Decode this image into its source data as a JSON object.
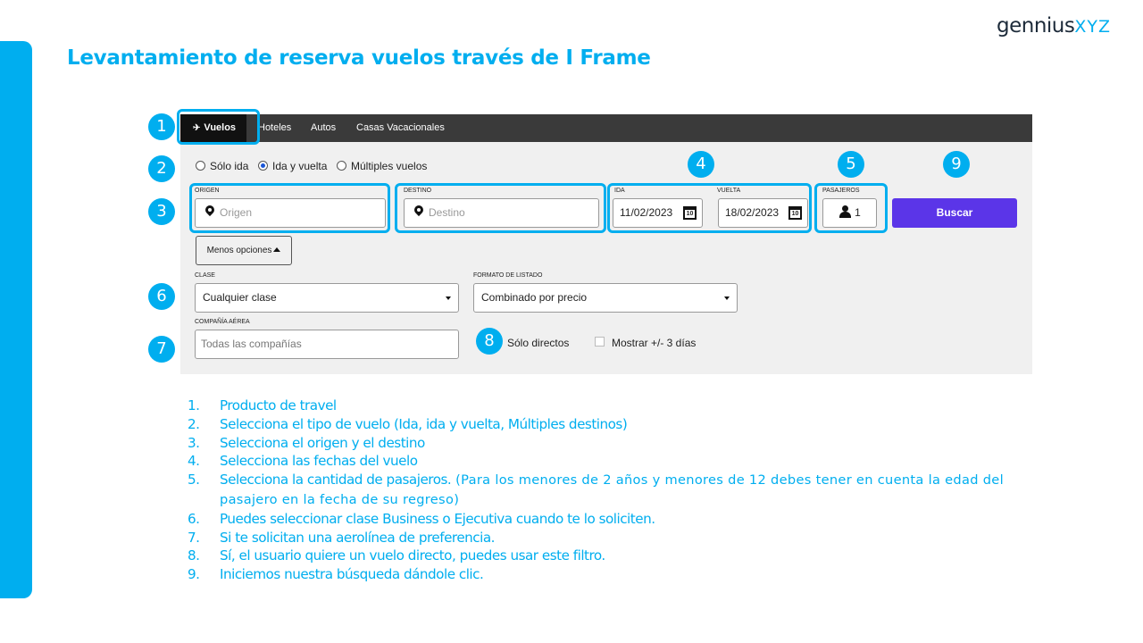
{
  "brand": {
    "name": "gennius",
    "suffix": "XYZ"
  },
  "slide_title": "Levantamiento de reserva vuelos través de I Frame",
  "tabs": [
    {
      "label": "Vuelos",
      "active": true
    },
    {
      "label": "Hoteles",
      "active": false
    },
    {
      "label": "Autos",
      "active": false
    },
    {
      "label": "Casas Vacacionales",
      "active": false
    }
  ],
  "trip_types": [
    {
      "label": "Sólo ida",
      "selected": false
    },
    {
      "label": "Ida y vuelta",
      "selected": true
    },
    {
      "label": "Múltiples vuelos",
      "selected": false
    }
  ],
  "search": {
    "origin_label": "ORIGEN",
    "origin_placeholder": "Origen",
    "destination_label": "DESTINO",
    "destination_placeholder": "Destino",
    "departure_label": "IDA",
    "departure_value": "11/02/2023",
    "return_label": "VUELTA",
    "return_value": "18/02/2023",
    "calendar_day": "10",
    "passengers_label": "PASAJEROS",
    "passengers_value": "1",
    "search_button": "Buscar",
    "less_options_button": "Menos opciones"
  },
  "options": {
    "class_label": "CLASE",
    "class_value": "Cualquier clase",
    "listing_label": "FORMATO DE LISTADO",
    "listing_value": "Combinado por precio",
    "airline_label": "COMPAÑÍA AÉREA",
    "airline_placeholder": "Todas las compañías",
    "direct_only_label": "Sólo directos",
    "plus_minus_label": "Mostrar +/- 3 días",
    "plus_minus_checked": false
  },
  "badges": [
    "1",
    "2",
    "3",
    "4",
    "5",
    "6",
    "7",
    "8",
    "9"
  ],
  "steps": [
    {
      "num": "1.",
      "text": "Producto de travel",
      "note": ""
    },
    {
      "num": "2.",
      "text": "Selecciona el tipo de vuelo (Ida, ida y vuelta, Múltiples destinos)",
      "note": ""
    },
    {
      "num": "3.",
      "text": "Selecciona el origen y el destino",
      "note": ""
    },
    {
      "num": "4.",
      "text": "Selecciona las fechas del vuelo",
      "note": ""
    },
    {
      "num": "5.",
      "text": "Selecciona la cantidad de pasajeros.",
      "note": " (Para los menores de 2 años y menores de 12 debes tener en cuenta la edad del pasajero en la fecha de su regreso)"
    },
    {
      "num": "6.",
      "text": "Puedes seleccionar clase Business o Ejecutiva cuando te lo soliciten.",
      "note": ""
    },
    {
      "num": "7.",
      "text": "Si te solicitan una aerolínea de preferencia.",
      "note": ""
    },
    {
      "num": "8.",
      "text": "Sí, el usuario quiere un vuelo directo, puedes usar este filtro.",
      "note": ""
    },
    {
      "num": "9.",
      "text": "Iniciemos nuestra búsqueda dándole clic.",
      "note": ""
    }
  ],
  "colors": {
    "accent": "#00aeef",
    "search_button": "#5b35e8",
    "tab_bar": "#3a3a3a",
    "widget_bg": "#f0f0f0"
  }
}
